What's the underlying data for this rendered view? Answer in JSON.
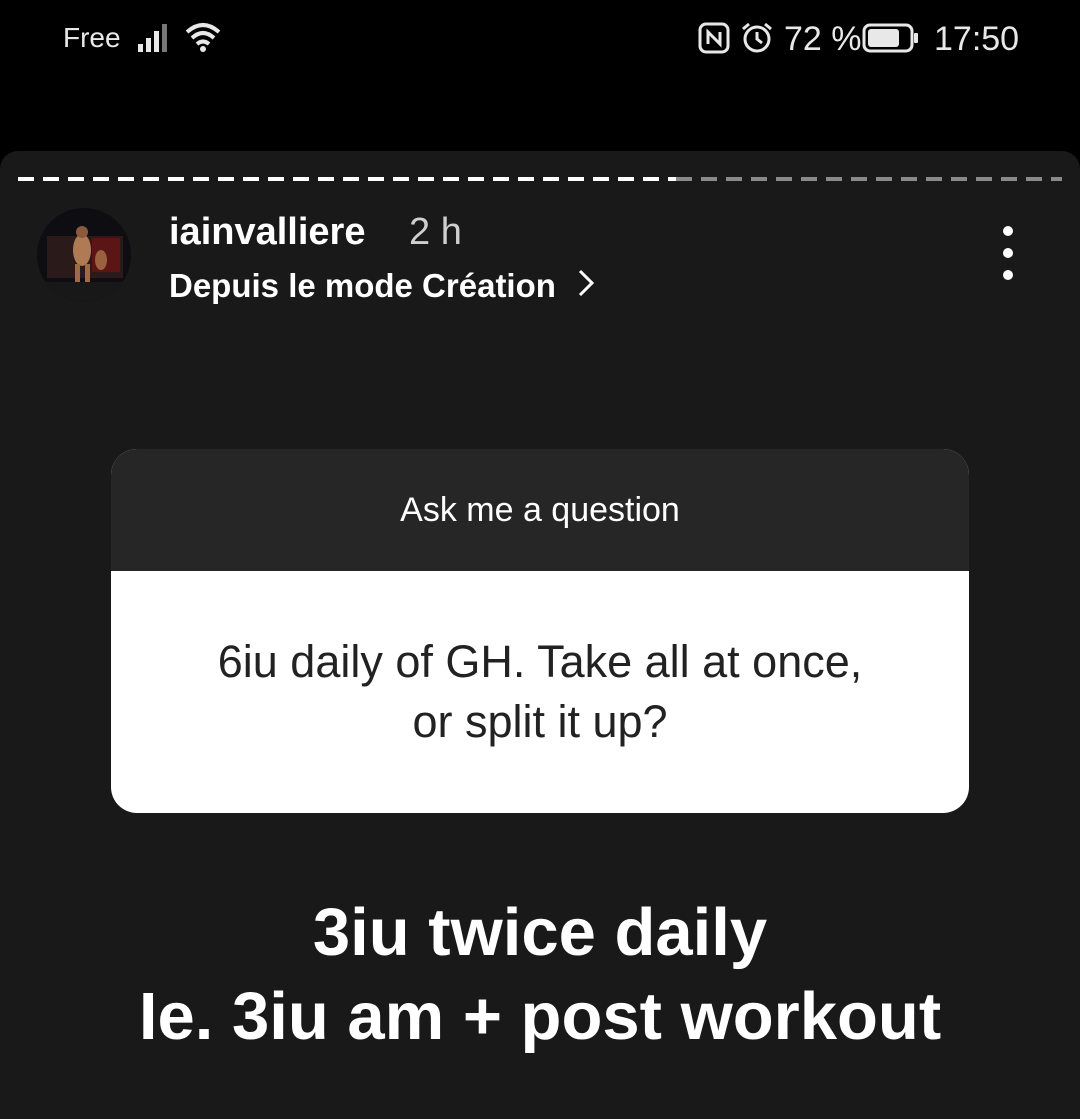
{
  "status_bar": {
    "carrier": "Free",
    "battery_percent": "72 %",
    "time": "17:50"
  },
  "story": {
    "progress_fraction": 0.63,
    "username": "iainvalliere",
    "time_ago": "2 h",
    "subtitle": "Depuis le mode Création",
    "question_card": {
      "header": "Ask me a question",
      "question_line1": "6iu daily of GH.  Take all at once,",
      "question_line2": "or split it up?"
    },
    "answer_line1": "3iu twice daily",
    "answer_line2": "Ie. 3iu am + post workout"
  },
  "icons": [
    "signal-icon",
    "wifi-icon",
    "nfc-icon",
    "alarm-icon",
    "battery-icon",
    "chevron-right-icon",
    "more-vertical-icon"
  ]
}
